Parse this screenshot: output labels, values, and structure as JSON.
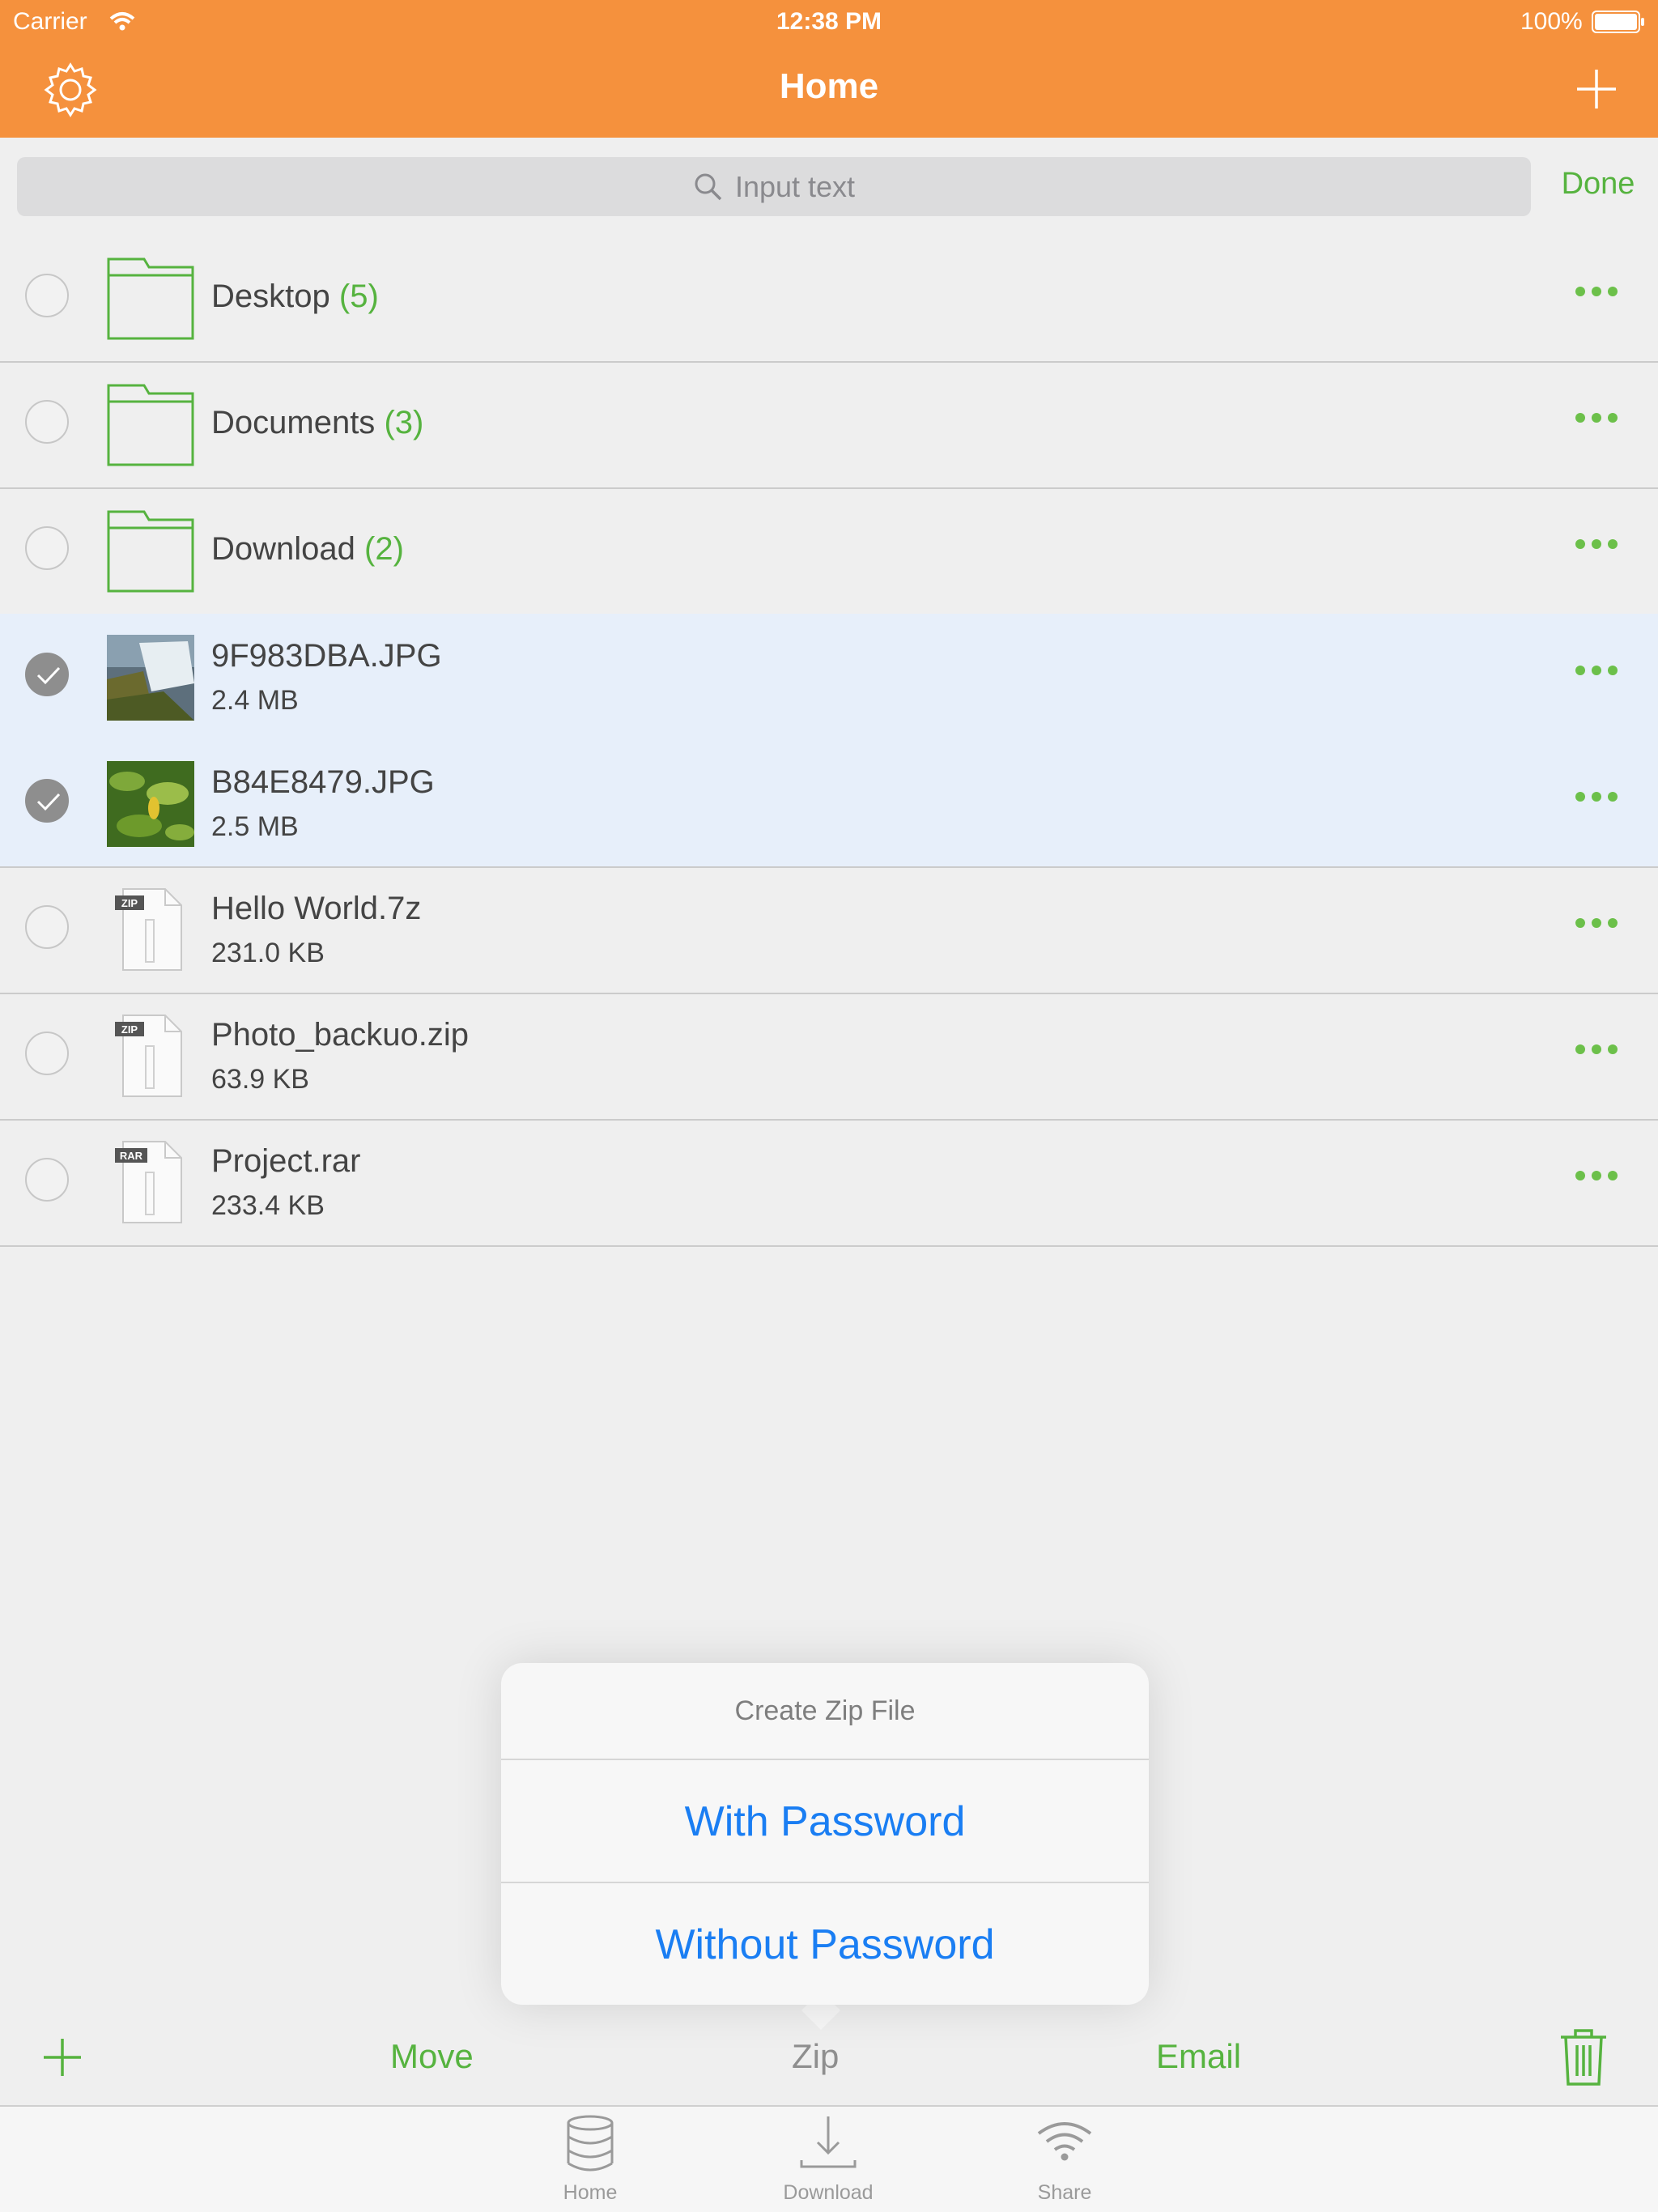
{
  "status_bar": {
    "carrier": "Carrier",
    "time": "12:38 PM",
    "battery": "100%"
  },
  "nav": {
    "title": "Home",
    "left_icon": "gear-icon",
    "right_icon": "plus-icon"
  },
  "search": {
    "placeholder": "Input text",
    "done_label": "Done"
  },
  "files": [
    {
      "name": "Desktop",
      "count": "(5)",
      "size": "",
      "kind": "folder",
      "selected": false
    },
    {
      "name": "Documents",
      "count": "(3)",
      "size": "",
      "kind": "folder",
      "selected": false
    },
    {
      "name": "Download",
      "count": "(2)",
      "size": "",
      "kind": "folder",
      "selected": false
    },
    {
      "name": "9F983DBA.JPG",
      "count": "",
      "size": "2.4 MB",
      "kind": "image",
      "selected": true
    },
    {
      "name": "B84E8479.JPG",
      "count": "",
      "size": "2.5 MB",
      "kind": "image",
      "selected": true
    },
    {
      "name": "Hello World.7z",
      "count": "",
      "size": "231.0 KB",
      "kind": "archive",
      "badge": "ZIP",
      "selected": false
    },
    {
      "name": "Photo_backuo.zip",
      "count": "",
      "size": "63.9 KB",
      "kind": "archive",
      "badge": "ZIP",
      "selected": false
    },
    {
      "name": "Project.rar",
      "count": "",
      "size": "233.4 KB",
      "kind": "archive",
      "badge": "RAR",
      "selected": false
    }
  ],
  "popover": {
    "title": "Create Zip File",
    "options": [
      "With Password",
      "Without Password"
    ]
  },
  "toolbar": {
    "add_icon": "plus-icon",
    "move": "Move",
    "zip": "Zip",
    "email": "Email",
    "delete_icon": "trash-icon"
  },
  "tabbar": {
    "tabs": [
      {
        "label": "Home",
        "icon": "database-icon"
      },
      {
        "label": "Download",
        "icon": "download-icon"
      },
      {
        "label": "Share",
        "icon": "wifi-icon"
      }
    ]
  },
  "colors": {
    "nav_bg": "#f5913d",
    "accent_green": "#56b33f",
    "link_blue": "#1a7ef3",
    "selected_row": "#e7effa"
  }
}
